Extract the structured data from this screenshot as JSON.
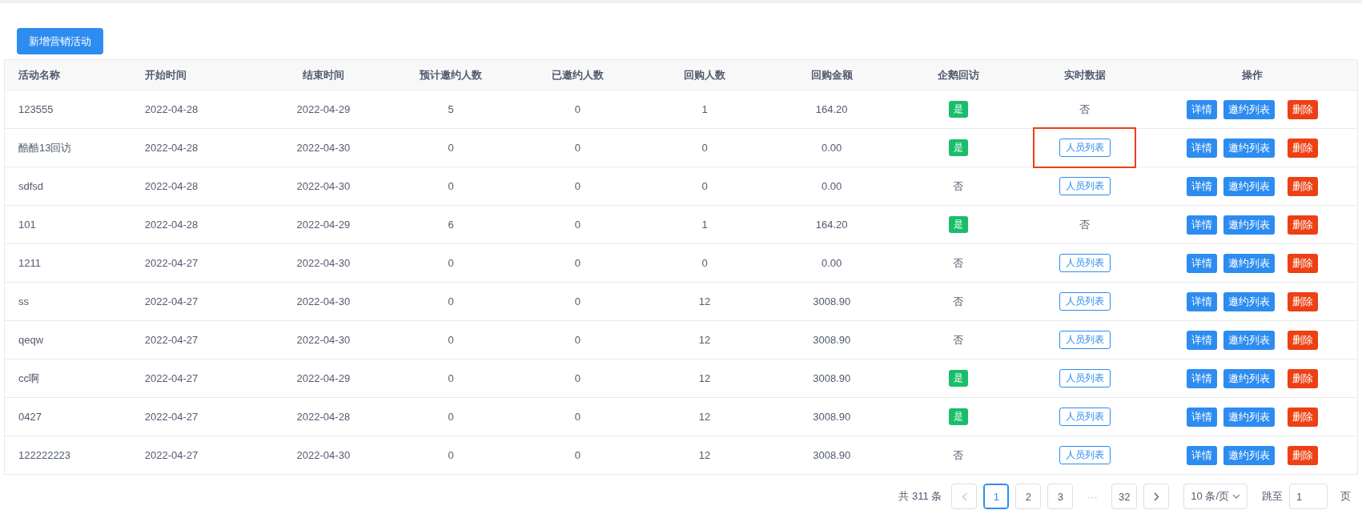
{
  "add_button": {
    "label": "新增营销活动"
  },
  "table": {
    "columns": [
      "活动名称",
      "开始时间",
      "结束时间",
      "预计邀约人数",
      "已邀约人数",
      "回购人数",
      "回购金额",
      "企鹅回访",
      "实时数据",
      "操作"
    ],
    "rows": [
      {
        "cells": [
          "123555",
          "2022-04-28",
          "2022-04-29",
          "5",
          "0",
          "1",
          "164.20"
        ],
        "visit": {
          "kind": "tag",
          "text": "是"
        },
        "realtime": {
          "kind": "text",
          "text": "否",
          "highlighted": false
        },
        "actions": [
          {
            "label": "详情",
            "kind": "primary"
          },
          {
            "label": "邀约列表",
            "kind": "primary"
          },
          {
            "label": "删除",
            "kind": "danger"
          }
        ]
      },
      {
        "cells": [
          "酷酷13回访",
          "2022-04-28",
          "2022-04-30",
          "0",
          "0",
          "0",
          "0.00"
        ],
        "visit": {
          "kind": "tag",
          "text": "是"
        },
        "realtime": {
          "kind": "button",
          "text": "人员列表",
          "highlighted": true
        },
        "actions": [
          {
            "label": "详情",
            "kind": "primary"
          },
          {
            "label": "邀约列表",
            "kind": "primary"
          },
          {
            "label": "删除",
            "kind": "danger"
          }
        ]
      },
      {
        "cells": [
          "sdfsd",
          "2022-04-28",
          "2022-04-30",
          "0",
          "0",
          "0",
          "0.00"
        ],
        "visit": {
          "kind": "text",
          "text": "否"
        },
        "realtime": {
          "kind": "button",
          "text": "人员列表",
          "highlighted": false
        },
        "actions": [
          {
            "label": "详情",
            "kind": "primary"
          },
          {
            "label": "邀约列表",
            "kind": "primary"
          },
          {
            "label": "删除",
            "kind": "danger"
          }
        ]
      },
      {
        "cells": [
          "101",
          "2022-04-28",
          "2022-04-29",
          "6",
          "0",
          "1",
          "164.20"
        ],
        "visit": {
          "kind": "tag",
          "text": "是"
        },
        "realtime": {
          "kind": "text",
          "text": "否",
          "highlighted": false
        },
        "actions": [
          {
            "label": "详情",
            "kind": "primary"
          },
          {
            "label": "邀约列表",
            "kind": "primary"
          },
          {
            "label": "删除",
            "kind": "danger"
          }
        ]
      },
      {
        "cells": [
          "1211",
          "2022-04-27",
          "2022-04-30",
          "0",
          "0",
          "0",
          "0.00"
        ],
        "visit": {
          "kind": "text",
          "text": "否"
        },
        "realtime": {
          "kind": "button",
          "text": "人员列表",
          "highlighted": false
        },
        "actions": [
          {
            "label": "详情",
            "kind": "primary"
          },
          {
            "label": "邀约列表",
            "kind": "primary"
          },
          {
            "label": "删除",
            "kind": "danger"
          }
        ]
      },
      {
        "cells": [
          "ss",
          "2022-04-27",
          "2022-04-30",
          "0",
          "0",
          "12",
          "3008.90"
        ],
        "visit": {
          "kind": "text",
          "text": "否"
        },
        "realtime": {
          "kind": "button",
          "text": "人员列表",
          "highlighted": false
        },
        "actions": [
          {
            "label": "详情",
            "kind": "primary"
          },
          {
            "label": "邀约列表",
            "kind": "primary"
          },
          {
            "label": "删除",
            "kind": "danger"
          }
        ]
      },
      {
        "cells": [
          "qeqw",
          "2022-04-27",
          "2022-04-30",
          "0",
          "0",
          "12",
          "3008.90"
        ],
        "visit": {
          "kind": "text",
          "text": "否"
        },
        "realtime": {
          "kind": "button",
          "text": "人员列表",
          "highlighted": false
        },
        "actions": [
          {
            "label": "详情",
            "kind": "primary"
          },
          {
            "label": "邀约列表",
            "kind": "primary"
          },
          {
            "label": "删除",
            "kind": "danger"
          }
        ]
      },
      {
        "cells": [
          "cc啊",
          "2022-04-27",
          "2022-04-29",
          "0",
          "0",
          "12",
          "3008.90"
        ],
        "visit": {
          "kind": "tag",
          "text": "是"
        },
        "realtime": {
          "kind": "button",
          "text": "人员列表",
          "highlighted": false
        },
        "actions": [
          {
            "label": "详情",
            "kind": "primary"
          },
          {
            "label": "邀约列表",
            "kind": "primary"
          },
          {
            "label": "删除",
            "kind": "danger"
          }
        ]
      },
      {
        "cells": [
          "0427",
          "2022-04-27",
          "2022-04-28",
          "0",
          "0",
          "12",
          "3008.90"
        ],
        "visit": {
          "kind": "tag",
          "text": "是"
        },
        "realtime": {
          "kind": "button",
          "text": "人员列表",
          "highlighted": false
        },
        "actions": [
          {
            "label": "详情",
            "kind": "primary"
          },
          {
            "label": "邀约列表",
            "kind": "primary"
          },
          {
            "label": "删除",
            "kind": "danger"
          }
        ]
      },
      {
        "cells": [
          "122222223",
          "2022-04-27",
          "2022-04-30",
          "0",
          "0",
          "12",
          "3008.90"
        ],
        "visit": {
          "kind": "text",
          "text": "否"
        },
        "realtime": {
          "kind": "button",
          "text": "人员列表",
          "highlighted": false
        },
        "actions": [
          {
            "label": "详情",
            "kind": "primary"
          },
          {
            "label": "邀约列表",
            "kind": "primary"
          },
          {
            "label": "删除",
            "kind": "danger"
          }
        ]
      }
    ]
  },
  "pagination": {
    "total": "共 311 条",
    "pages": [
      {
        "label": "1",
        "selected": true
      },
      {
        "label": "2",
        "selected": false
      },
      {
        "label": "3",
        "selected": false
      },
      {
        "label": "···",
        "kind": "ellipsis"
      },
      {
        "label": "32",
        "selected": false
      }
    ],
    "page_size": "10 条/页",
    "jump_label": "跳至",
    "jump_value": "1",
    "jump_suffix": "页"
  }
}
